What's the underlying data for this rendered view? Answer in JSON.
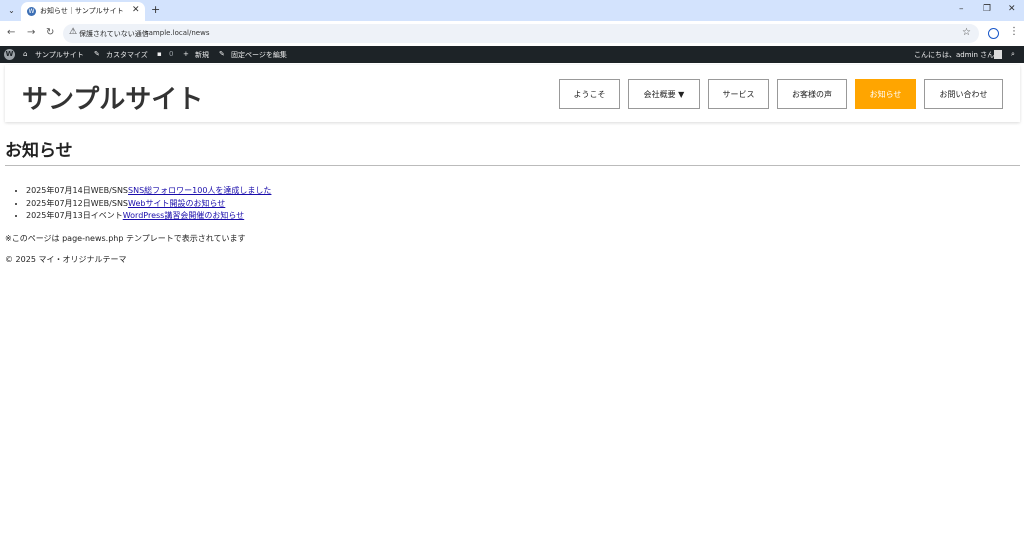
{
  "browser": {
    "tab_title": "お知らせ｜サンプルサイト",
    "insecure_label": "保護されていない通信",
    "url": "sample.local/news"
  },
  "adminbar": {
    "site_name": "サンプルサイト",
    "customize": "カスタマイズ",
    "comments_count": "0",
    "new": "新規",
    "edit_page": "固定ページを編集",
    "greeting": "こんにちは、admin さん"
  },
  "site": {
    "title": "サンプルサイト",
    "nav": [
      {
        "label": "ようこそ"
      },
      {
        "label": "会社概要 ▼"
      },
      {
        "label": "サービス"
      },
      {
        "label": "お客様の声"
      },
      {
        "label": "お知らせ"
      },
      {
        "label": "お問い合わせ"
      }
    ],
    "active_color": "#ffa500"
  },
  "main": {
    "page_title": "お知らせ",
    "news": [
      {
        "date": "2025年07月14日",
        "category": "WEB/SNS",
        "title": "SNS総フォロワー100人を達成しました"
      },
      {
        "date": "2025年07月12日",
        "category": "WEB/SNS",
        "title": "Webサイト開設のお知らせ"
      },
      {
        "date": "2025年07月13日",
        "category": "イベント",
        "title": "WordPress講習会開催のお知らせ"
      }
    ],
    "note": "※このページは page-news.php テンプレートで表示されています",
    "footer": "© 2025 マイ・オリジナルテーマ"
  }
}
